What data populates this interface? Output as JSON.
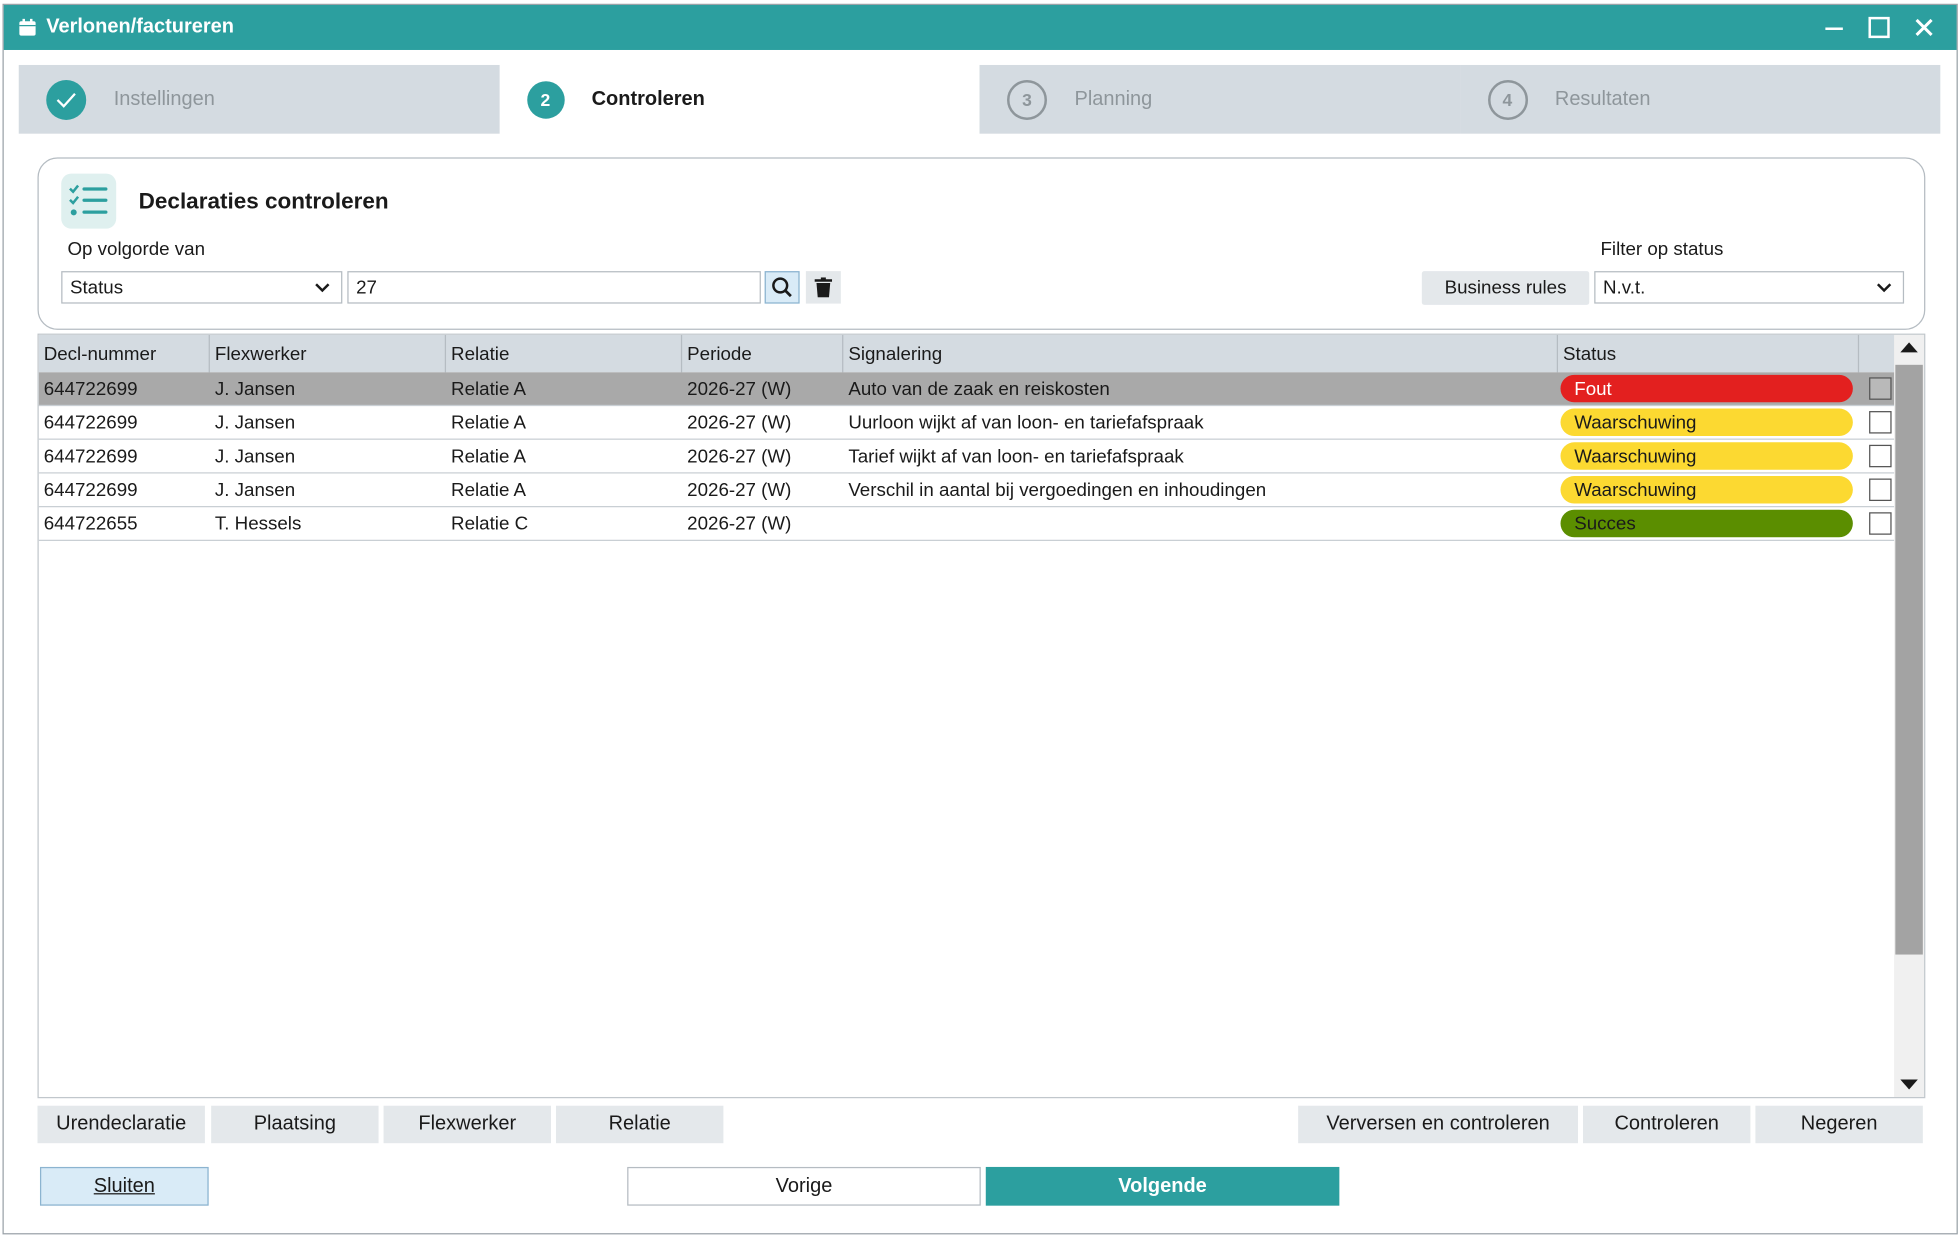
{
  "window": {
    "title": "Verlonen/factureren"
  },
  "steps": [
    {
      "number": "",
      "label": "Instellingen",
      "state": "done"
    },
    {
      "number": "2",
      "label": "Controleren",
      "state": "current"
    },
    {
      "number": "3",
      "label": "Planning",
      "state": "todo"
    },
    {
      "number": "4",
      "label": "Resultaten",
      "state": "todo"
    }
  ],
  "panel": {
    "title": "Declaraties controleren",
    "sort_label": "Op volgorde van",
    "sort_value": "Status",
    "search_value": "27",
    "filter_label": "Filter op status",
    "business_rules_label": "Business rules",
    "filter_value": "N.v.t."
  },
  "table": {
    "columns": [
      "Decl-nummer",
      "Flexwerker",
      "Relatie",
      "Periode",
      "Signalering",
      "Status"
    ],
    "rows": [
      {
        "decl": "644722699",
        "flex": "J. Jansen",
        "relatie": "Relatie A",
        "periode": "2026-27 (W)",
        "signalering": "Auto van de zaak en reiskosten",
        "status": "Fout"
      },
      {
        "decl": "644722699",
        "flex": "J. Jansen",
        "relatie": "Relatie A",
        "periode": "2026-27 (W)",
        "signalering": "Uurloon wijkt af van loon- en tariefafspraak",
        "status": "Waarschuwing"
      },
      {
        "decl": "644722699",
        "flex": "J. Jansen",
        "relatie": "Relatie A",
        "periode": "2026-27 (W)",
        "signalering": "Tarief wijkt af van loon- en tariefafspraak",
        "status": "Waarschuwing"
      },
      {
        "decl": "644722699",
        "flex": "J. Jansen",
        "relatie": "Relatie A",
        "periode": "2026-27 (W)",
        "signalering": "Verschil in aantal bij vergoedingen en inhoudingen",
        "status": "Waarschuwing"
      },
      {
        "decl": "644722655",
        "flex": "T. Hessels",
        "relatie": "Relatie C",
        "periode": "2026-27 (W)",
        "signalering": "",
        "status": "Succes"
      }
    ]
  },
  "status_colors": {
    "Fout": "#e3201f",
    "Waarschuwing": "#fcd931",
    "Succes": "#5b8e00"
  },
  "status_text_colors": {
    "Fout": "#ffffff",
    "Waarschuwing": "#1a1a1a",
    "Succes": "#1a1a1a"
  },
  "left_actions": [
    "Urendeclaratie",
    "Plaatsing",
    "Flexwerker",
    "Relatie"
  ],
  "right_actions": [
    "Verversen en controleren",
    "Controleren",
    "Negeren"
  ],
  "footer": {
    "close_label": "Sluiten",
    "prev_label": "Vorige",
    "next_label": "Volgende"
  },
  "colors": {
    "accent": "#2c9f9f",
    "step_inactive_bg": "#d4dbe1",
    "header_bg": "#d4dbe1",
    "selected_row": "#a9a9a9"
  }
}
